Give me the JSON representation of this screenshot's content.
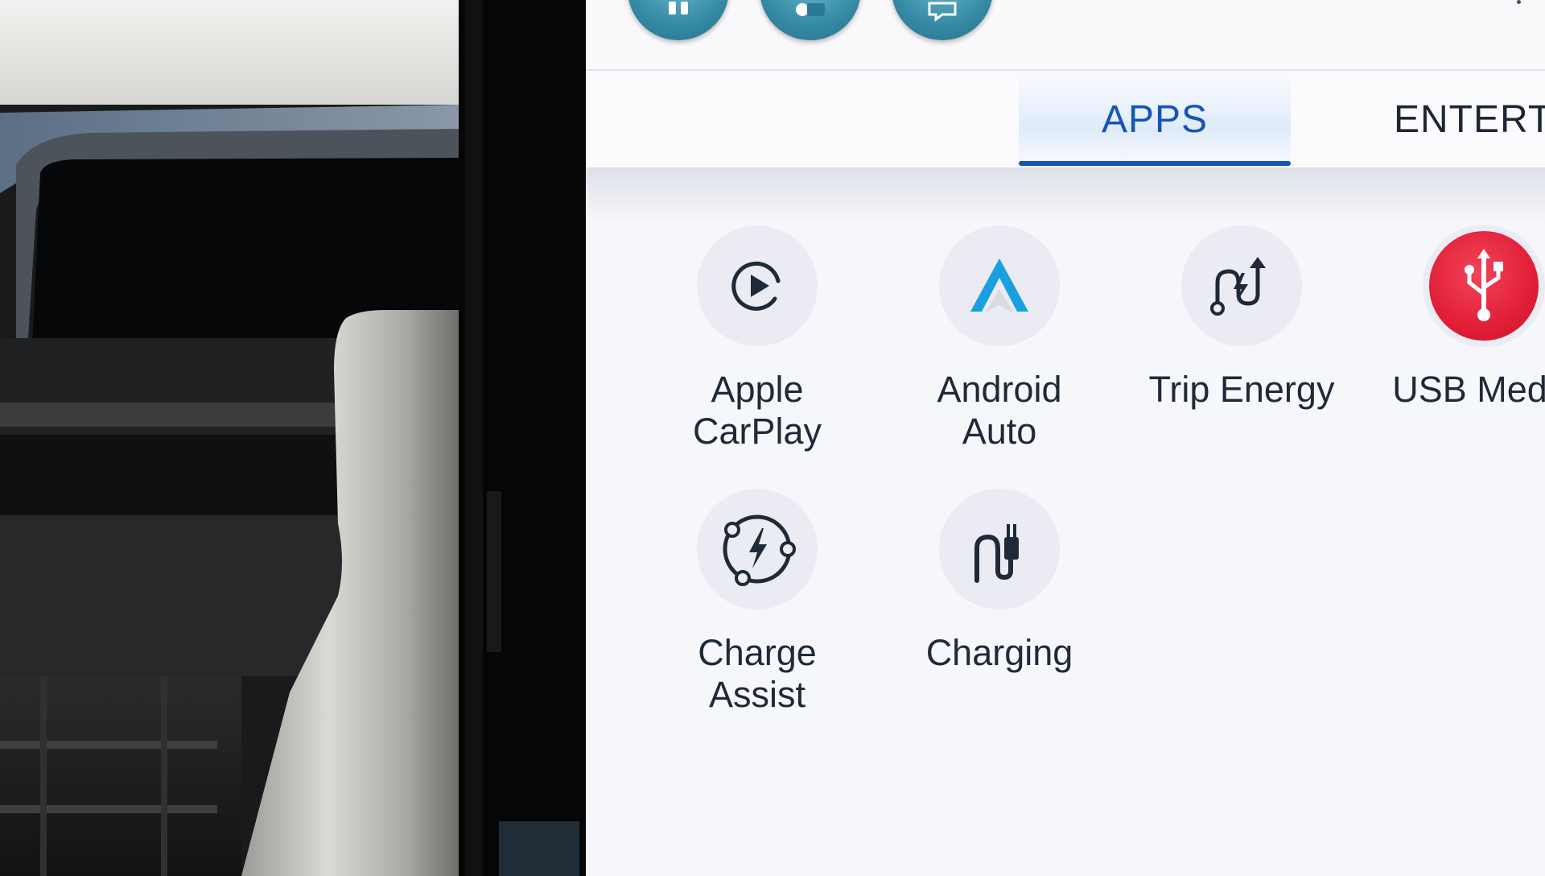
{
  "tabs": {
    "apps": "APPS",
    "entertainment": "ENTERTA"
  },
  "apps": [
    {
      "id": "apple-carplay",
      "line1": "Apple",
      "line2": "CarPlay",
      "icon": "play-circle-icon"
    },
    {
      "id": "android-auto",
      "line1": "Android",
      "line2": "Auto",
      "icon": "android-auto-icon"
    },
    {
      "id": "trip-energy",
      "line1": "Trip Energy",
      "line2": "",
      "icon": "trip-energy-icon"
    },
    {
      "id": "usb-media",
      "line1": "USB Media",
      "line2": "",
      "icon": "usb-icon"
    },
    {
      "id": "charge-assist",
      "line1": "Charge",
      "line2": "Assist",
      "icon": "charge-assist-icon"
    },
    {
      "id": "charging",
      "line1": "Charging",
      "line2": "",
      "icon": "charging-plug-icon"
    }
  ],
  "colors": {
    "accent": "#1456b8",
    "text": "#1f2a38",
    "icon_circle": "#ebebf4",
    "usb_red": "#e31e37",
    "android_blue": "#1a9fe0",
    "quick_button_teal": "#3a8fa9"
  }
}
